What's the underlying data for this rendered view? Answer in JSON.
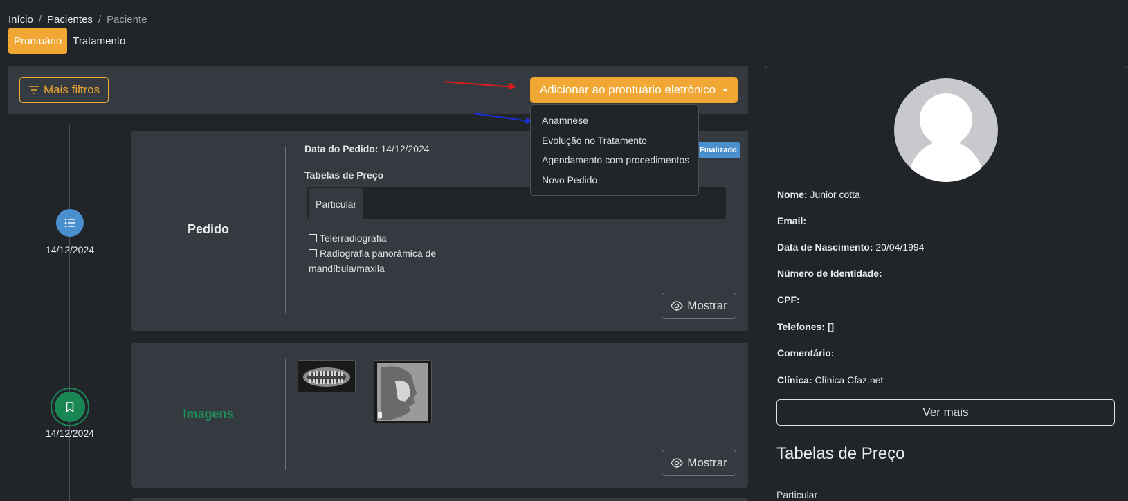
{
  "breadcrumb": {
    "home": "Início",
    "patients": "Pacientes",
    "current": "Paciente"
  },
  "tabs": {
    "record": "Prontuário",
    "treatment": "Tratamento"
  },
  "toolbar": {
    "filters_label": "Mais filtros",
    "add_label": "Adicionar ao prontuário eletrônico"
  },
  "dropdown": {
    "items": [
      "Anamnese",
      "Evolução no Tratamento",
      "Agendamento com procedimentos",
      "Novo Pedido"
    ]
  },
  "timeline": [
    {
      "date": "14/12/2024",
      "type_label": "Pedido",
      "status": "Finalizado",
      "order_date_label": "Data do Pedido:",
      "order_date": "14/12/2024",
      "price_tables_label": "Tabelas de Preço",
      "price_tab": "Particular",
      "procedures": [
        "Telerradiografia",
        "Radiografia panorâmica de",
        "mandíbula/maxila"
      ],
      "show_label": "Mostrar"
    },
    {
      "date": "14/12/2024",
      "type_label": "Imagens",
      "show_label": "Mostrar"
    }
  ],
  "patient": {
    "name_label": "Nome:",
    "name": "Junior cotta",
    "email_label": "Email:",
    "birth_label": "Data de Nascimento:",
    "birth": "20/04/1994",
    "id_label": "Número de Identidade:",
    "cpf_label": "CPF:",
    "phones_label": "Telefones:",
    "phones": "[]",
    "comment_label": "Comentário:",
    "clinic_label": "Clínica:",
    "clinic": "Clínica Cfaz.net",
    "more_label": "Ver mais",
    "price_tables_heading": "Tabelas de Preço",
    "price_table_first": "Particular"
  },
  "colors": {
    "accent": "#f0a733",
    "info": "#4a8fce",
    "success": "#198754",
    "bg": "#212529",
    "card": "#343a40"
  }
}
